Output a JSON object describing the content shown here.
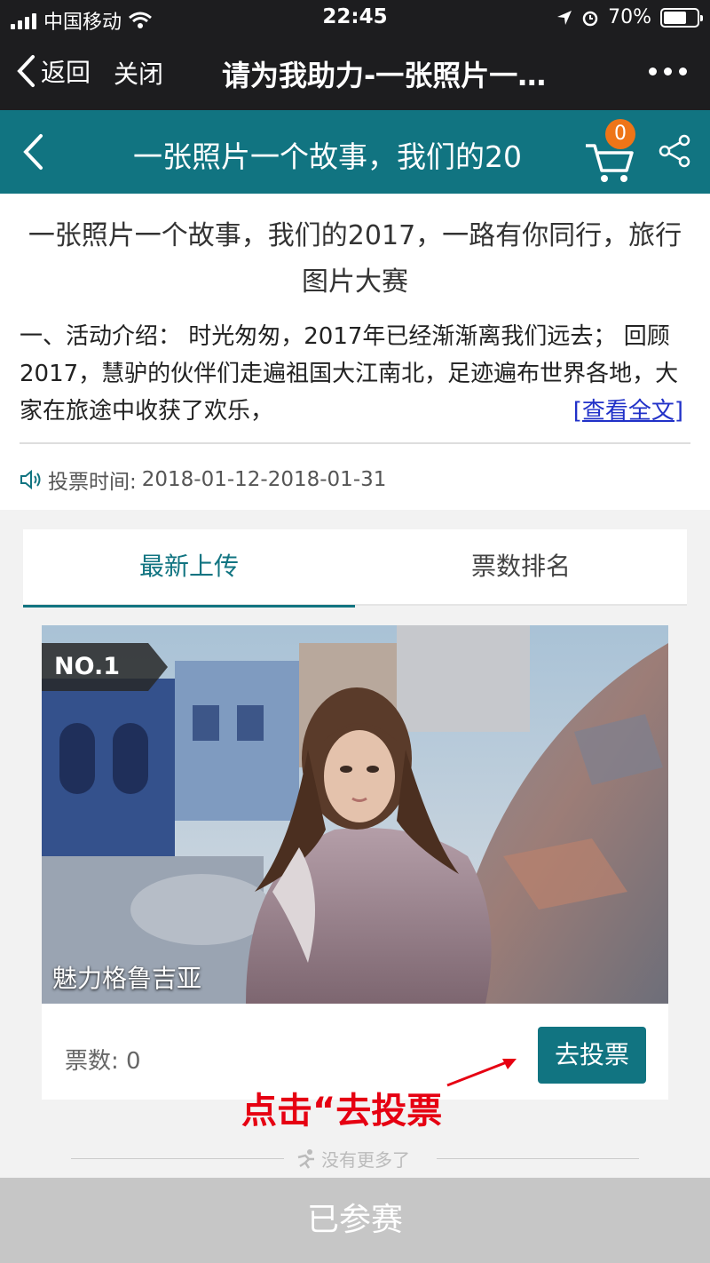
{
  "status_bar": {
    "carrier": "中国移动",
    "time": "22:45",
    "battery": "70%",
    "battery_level": 0.7
  },
  "wechat_nav": {
    "back": "返回",
    "close": "关闭",
    "title": "请为我助力-一张照片一…"
  },
  "header": {
    "title": "一张照片一个故事，我们的20",
    "cart_count": "0"
  },
  "intro": {
    "headline": "一张照片一个故事，我们的2017，一路有你同行，旅行图片大赛",
    "desc": "一、活动介绍： 时光匆匆，2017年已经渐渐离我们远去； 回顾2017，慧驴的伙伴们走遍祖国大江南北，足迹遍布世界各地，大家在旅途中收获了欢乐，",
    "read_more": "[查看全文]",
    "vote_time_label": "投票时间:",
    "vote_time_value": "2018-01-12-2018-01-31"
  },
  "tabs": [
    {
      "label": "最新上传",
      "active": true
    },
    {
      "label": "票数排名",
      "active": false
    }
  ],
  "entry": {
    "rank": "NO.1",
    "caption": "魅力格鲁吉亚",
    "votes_label": "票数:",
    "votes_value": "0",
    "vote_button": "去投票"
  },
  "annotation": "点击“去投票",
  "no_more": "没有更多了",
  "bottom_button": "已参赛",
  "colors": {
    "accent": "#117481",
    "badge": "#ee7518",
    "annotation": "#e60012"
  }
}
